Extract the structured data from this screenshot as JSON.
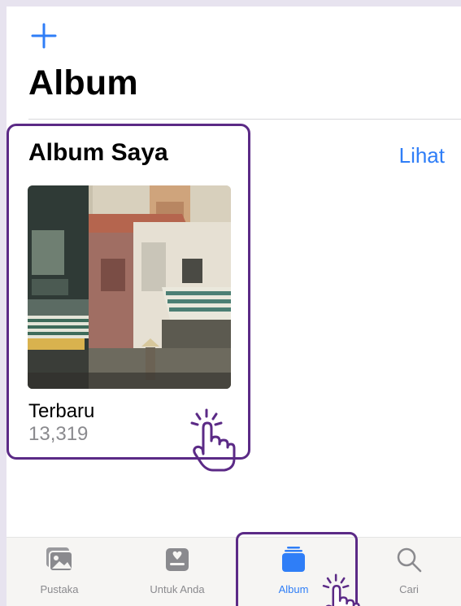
{
  "header": {
    "page_title": "Album"
  },
  "my_albums": {
    "section_title": "Album Saya",
    "see_all_label": "Lihat",
    "albums": [
      {
        "name": "Terbaru",
        "count": "13,319"
      }
    ]
  },
  "tabbar": {
    "tabs": [
      {
        "label": "Pustaka",
        "icon": "photo-library-icon",
        "active": false
      },
      {
        "label": "Untuk Anda",
        "icon": "for-you-icon",
        "active": false
      },
      {
        "label": "Album",
        "icon": "album-stack-icon",
        "active": true
      },
      {
        "label": "Cari",
        "icon": "search-icon",
        "active": false
      }
    ]
  },
  "colors": {
    "accent": "#2f7ef7",
    "highlight": "#5b2a86",
    "inactive": "#8a8a8e"
  }
}
